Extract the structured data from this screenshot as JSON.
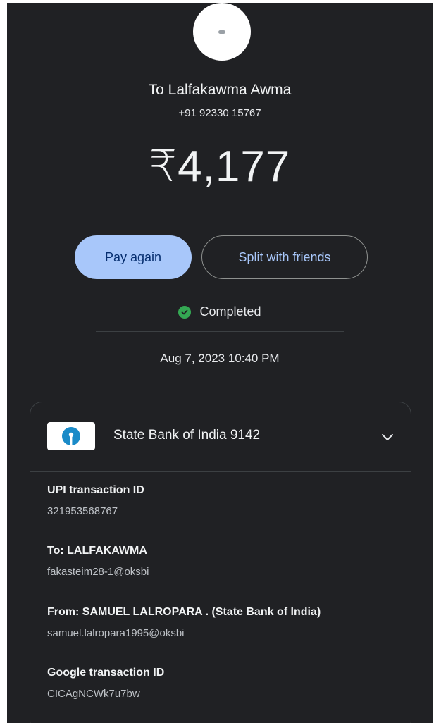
{
  "header": {
    "avatar_icon": "contact-avatar-icon",
    "recipient_name": "To Lalfakawma Awma",
    "recipient_phone": "+91 92330 15767"
  },
  "amount": "₹4,177",
  "actions": {
    "pay_again_label": "Pay again",
    "split_label": "Split with friends"
  },
  "status": {
    "icon": "check-circle-icon",
    "label": "Completed",
    "color": "#34a853"
  },
  "date": "Aug 7, 2023 10:40 PM",
  "payment_source": {
    "bank_icon": "sbi-logo-icon",
    "bank_label": "State Bank of India 9142",
    "expand_icon": "chevron-down-icon"
  },
  "details": [
    {
      "label": "UPI transaction ID",
      "value": "321953568767"
    },
    {
      "label": "To: LALFAKAWMA",
      "value": "fakasteim28-1@oksbi"
    },
    {
      "label": "From: SAMUEL LALROPARA  . (State Bank of India)",
      "value": "samuel.lalropara1995@oksbi"
    },
    {
      "label": "Google transaction ID",
      "value": "CICAgNCWk7u7bw"
    }
  ],
  "colors": {
    "background": "#202124",
    "accent": "#a8c7fa",
    "success": "#34a853"
  }
}
